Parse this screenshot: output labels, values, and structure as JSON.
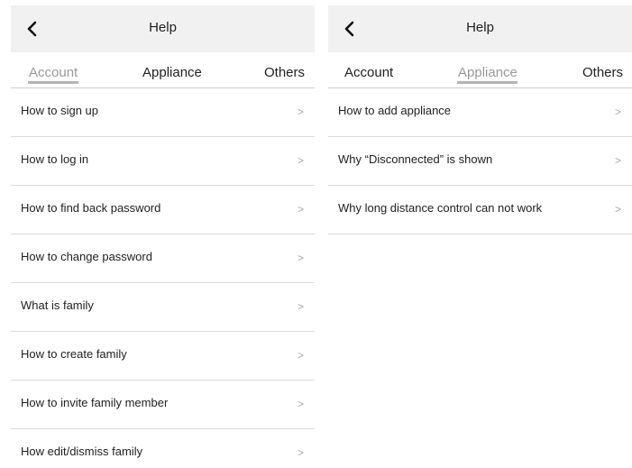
{
  "left": {
    "header": {
      "title": "Help"
    },
    "tabs": [
      {
        "label": "Account",
        "active": true
      },
      {
        "label": "Appliance",
        "active": false
      },
      {
        "label": "Others",
        "active": false
      }
    ],
    "items": [
      {
        "label": "How to sign up",
        "chevron": ">"
      },
      {
        "label": "How to log in",
        "chevron": ">"
      },
      {
        "label": "How to find back password",
        "chevron": ">"
      },
      {
        "label": "How to change password",
        "chevron": ">"
      },
      {
        "label": "What is family",
        "chevron": ">"
      },
      {
        "label": "How to create family",
        "chevron": ">"
      },
      {
        "label": "How to invite family member",
        "chevron": ">"
      },
      {
        "label": "How edit/dismiss family",
        "chevron": ">"
      }
    ]
  },
  "right": {
    "header": {
      "title": "Help"
    },
    "tabs": [
      {
        "label": "Account",
        "active": false
      },
      {
        "label": "Appliance",
        "active": true
      },
      {
        "label": "Others",
        "active": false
      }
    ],
    "items": [
      {
        "label": "How to add appliance",
        "chevron": ">"
      },
      {
        "label": "Why “Disconnected” is shown",
        "chevron": ">"
      },
      {
        "label": "Why long distance control can not work",
        "chevron": ">"
      }
    ]
  },
  "icons": {
    "back": "back-arrow-icon",
    "row": "chevron-right-icon"
  },
  "colors": {
    "header_bg": "#f1f1f1",
    "active_tab": "#9a9a9a",
    "underline": "#b5b5b5"
  }
}
